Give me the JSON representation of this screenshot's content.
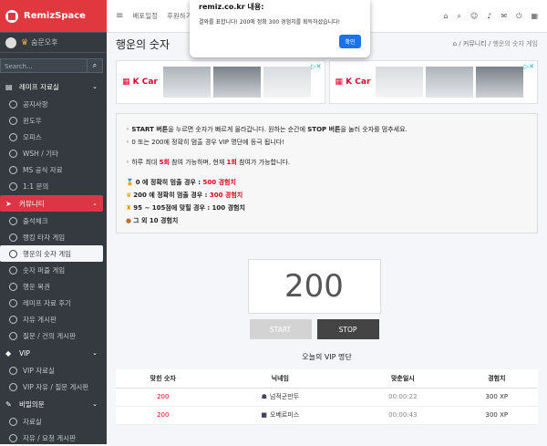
{
  "sidebar": {
    "brand": "RemizSpace",
    "user": {
      "level_icon": "crown",
      "name": "숨문오후"
    },
    "search_placeholder": "Search...",
    "groups": [
      {
        "label": "레미프 자료실",
        "icon": "book",
        "open": false,
        "items": [
          "공지사항",
          "윈도우",
          "오피스",
          "WSH / 기타",
          "MS 공식 자료",
          "1:1 문의"
        ]
      },
      {
        "label": "커뮤니티",
        "icon": "paper-plane",
        "open": true,
        "items": [
          "출석체크",
          "랭킹 타자 게임",
          "행운의 숫자 게임",
          "숫자 퍼즐 게임",
          "행운 복권",
          "레미프 자료 후기",
          "자유 게시판",
          "질문 / 건의 게시판"
        ]
      },
      {
        "label": "VIP",
        "icon": "diamond",
        "open": false,
        "items": [
          "VIP 자료실",
          "VIP 자유 / 질문 게시판"
        ]
      },
      {
        "label": "비밀의문",
        "icon": "wrench",
        "open": false,
        "items": [
          "자료실",
          "자유 / 요청 게시판"
        ]
      }
    ],
    "active_item": "행운의 숫자 게임"
  },
  "topbar": {
    "links": [
      "배포일정",
      "후원하기"
    ]
  },
  "dialog": {
    "title": "remiz.co.kr 내용:",
    "message": "결와를 표합니다! 200에 정확 300 경험치를 획득하셨습니다!",
    "ok_label": "확인"
  },
  "page": {
    "title": "행운의 숫자",
    "breadcrumb": [
      "커뮤니티",
      "행운의 숫자 게임"
    ]
  },
  "ads": [
    {
      "brand": "K Car"
    },
    {
      "brand": "K Car"
    }
  ],
  "info": {
    "l1a": "◦ ",
    "l1b": "START 버튼",
    "l1c": "을 누르면 숫자가 빠르게 올라갑니다. 원하는 순간에 ",
    "l1d": "STOP 버튼",
    "l1e": "을 눌러 숫자를 멈추세요.",
    "l2": "◦ 0 또는 200에 정확히 멈출 경우 VIP 명단에 등극 됩니다!",
    "l3a": "◦ 하루 최대 ",
    "l3b": "5회",
    "l3c": " 참여 가능하며, 현재 ",
    "l3d": "1회",
    "l3e": " 참여가 가능합니다.",
    "r1a": "0 에 정확히 멈출 경우 : ",
    "r1b": "500 경험치",
    "r2a": "200 에 정확히 멈출 경우 : ",
    "r2b": "300 경험치",
    "r3": "95 ~ 105점에 맞힐 경우 : 100 경험치",
    "r4": "그 외 10 경험치"
  },
  "game": {
    "number": "200",
    "start_label": "START",
    "stop_label": "STOP"
  },
  "vip": {
    "title": "오늘의 VIP 명단",
    "columns": [
      "맞힌 숫자",
      "닉네임",
      "맞춘일시",
      "경험치"
    ],
    "rows": [
      {
        "score": "200",
        "nick": "넘적군만두",
        "time": "00:00:22",
        "xp": "300 XP"
      },
      {
        "score": "200",
        "nick": "오베르미스",
        "time": "00:00:43",
        "xp": "300 XP"
      }
    ]
  }
}
